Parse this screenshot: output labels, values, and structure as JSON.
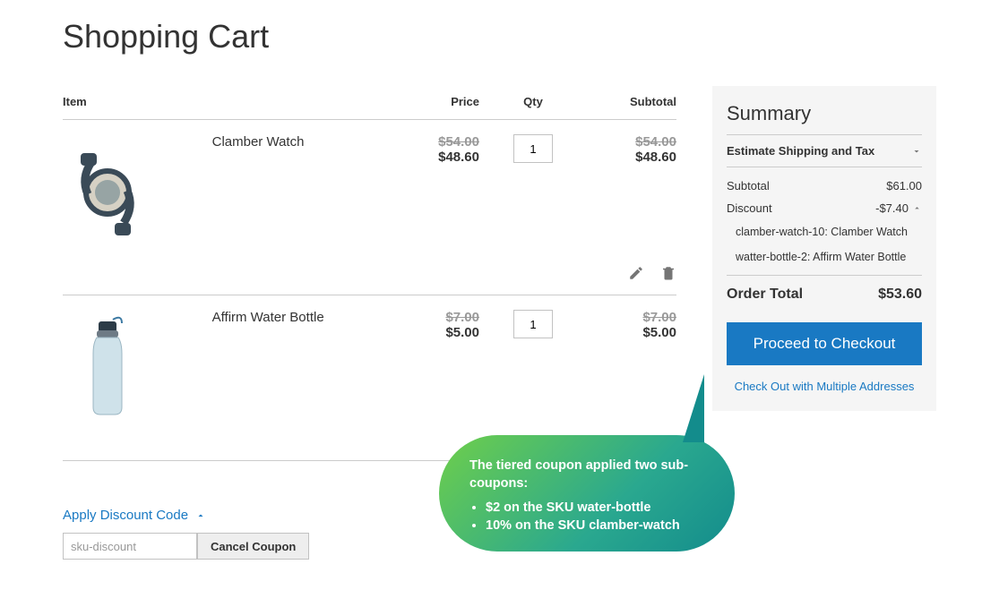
{
  "page_title": "Shopping Cart",
  "headers": {
    "item": "Item",
    "price": "Price",
    "qty": "Qty",
    "subtotal": "Subtotal"
  },
  "items": [
    {
      "name": "Clamber Watch",
      "price_old": "$54.00",
      "price_new": "$48.60",
      "qty": "1",
      "sub_old": "$54.00",
      "sub_new": "$48.60"
    },
    {
      "name": "Affirm Water Bottle",
      "price_old": "$7.00",
      "price_new": "$5.00",
      "qty": "1",
      "sub_old": "$7.00",
      "sub_new": "$5.00"
    }
  ],
  "discount": {
    "toggle_label": "Apply Discount Code",
    "code_value": "sku-discount",
    "cancel_label": "Cancel Coupon"
  },
  "summary": {
    "title": "Summary",
    "estimate_label": "Estimate Shipping and Tax",
    "subtotal_label": "Subtotal",
    "subtotal_value": "$61.00",
    "discount_label": "Discount",
    "discount_value": "-$7.40",
    "discount_details": [
      "clamber-watch-10: Clamber Watch",
      "watter-bottle-2: Affirm Water Bottle"
    ],
    "order_total_label": "Order Total",
    "order_total_value": "$53.60",
    "checkout_label": "Proceed to Checkout",
    "multi_address_label": "Check Out with Multiple Addresses"
  },
  "callout": {
    "text": "The tiered coupon applied two sub-coupons:",
    "bullets": [
      "$2 on the SKU water-bottle",
      "10% on the SKU clamber-watch"
    ]
  }
}
